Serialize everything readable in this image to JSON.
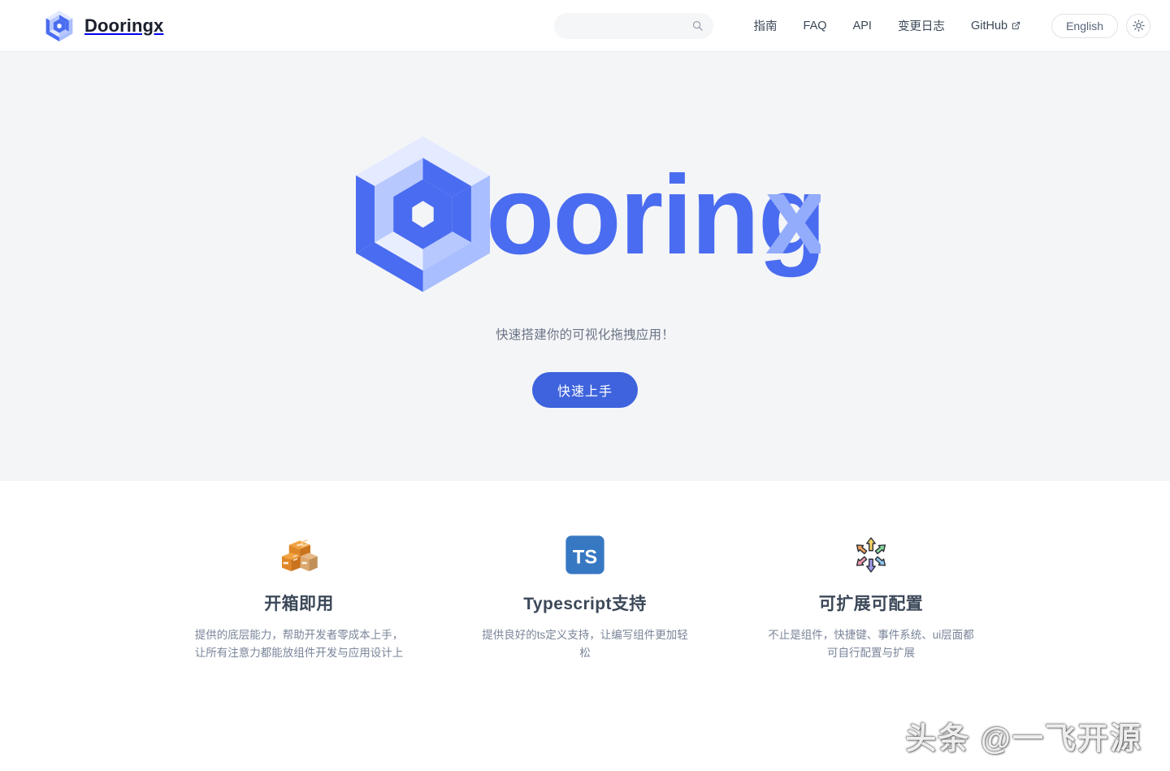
{
  "header": {
    "brand": {
      "title": "Dooringx",
      "logo_icon": "dooringx-cube-logo"
    },
    "search": {
      "value": "",
      "placeholder": "",
      "icon": "search-icon"
    },
    "nav_links": [
      {
        "label": "指南",
        "external": false
      },
      {
        "label": "FAQ",
        "external": false
      },
      {
        "label": "API",
        "external": false
      },
      {
        "label": "变更日志",
        "external": false
      },
      {
        "label": "GitHub",
        "external": true,
        "icon": "external-link-icon"
      }
    ],
    "language_button": {
      "label": "English"
    },
    "theme_toggle": {
      "icon": "sun-icon",
      "mode": "light"
    }
  },
  "hero": {
    "logo_wordmark": "Dooringx",
    "logo_mark_icon": "dooringx-cube-logo",
    "tagline": "快速搭建你的可视化拖拽应用！",
    "cta_label": "快速上手",
    "background_color": "#f4f5f7",
    "accent_color": "#3e63dd",
    "accent_light_color": "#93acfc"
  },
  "features": [
    {
      "icon": "package-boxes-icon",
      "title": "开箱即用",
      "desc": "提供的底层能力，帮助开发者零成本上手，让所有注意力都能放组件开发与应用设计上"
    },
    {
      "icon": "typescript-logo-icon",
      "title": "Typescript支持",
      "desc": "提供良好的ts定义支持，让编写组件更加轻松"
    },
    {
      "icon": "multi-direction-arrows-icon",
      "title": "可扩展可配置",
      "desc": "不止是组件，快捷键、事件系统、ui层面都可自行配置与扩展"
    }
  ],
  "watermark": {
    "text": "头条 @一飞开源"
  }
}
